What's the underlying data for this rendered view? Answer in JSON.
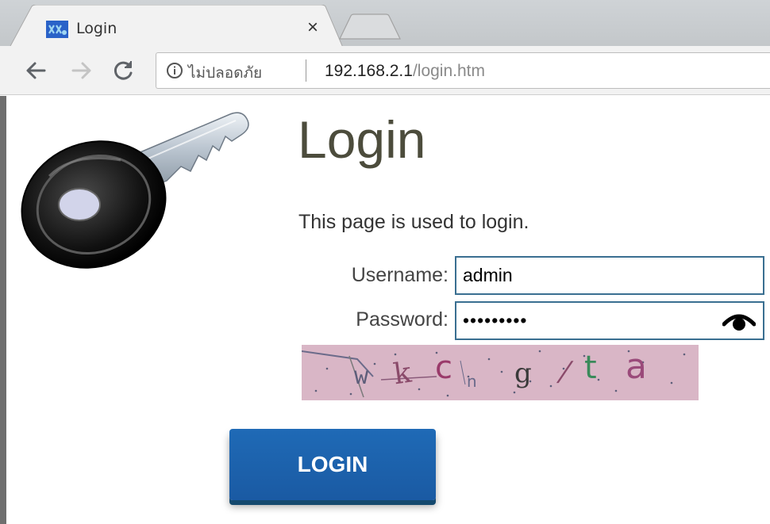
{
  "browser": {
    "tab": {
      "title": "Login",
      "favicon": "router-favicon-icon",
      "close": "×"
    },
    "nav": {
      "back": "arrow-left-icon",
      "forward": "arrow-right-icon",
      "reload": "reload-icon"
    },
    "omnibox": {
      "security_icon": "info-icon",
      "security_text": "ไม่ปลอดภัย",
      "url_host": "192.168.2.1",
      "url_path": "/login.htm"
    }
  },
  "page": {
    "illustration": "key-icon",
    "title": "Login",
    "description": "This page is used to login.",
    "form": {
      "username_label": "Username:",
      "username_value": "admin",
      "password_label": "Password:",
      "password_value": "•••••••••",
      "show_password_icon": "eye-icon",
      "captcha_text": "wkcngta"
    },
    "login_button": "LOGIN"
  },
  "colors": {
    "button": "#1f6ab6",
    "field_border": "#3a6f91",
    "captcha_bg": "#d9b6c6",
    "title_text": "#4c4c3c"
  }
}
